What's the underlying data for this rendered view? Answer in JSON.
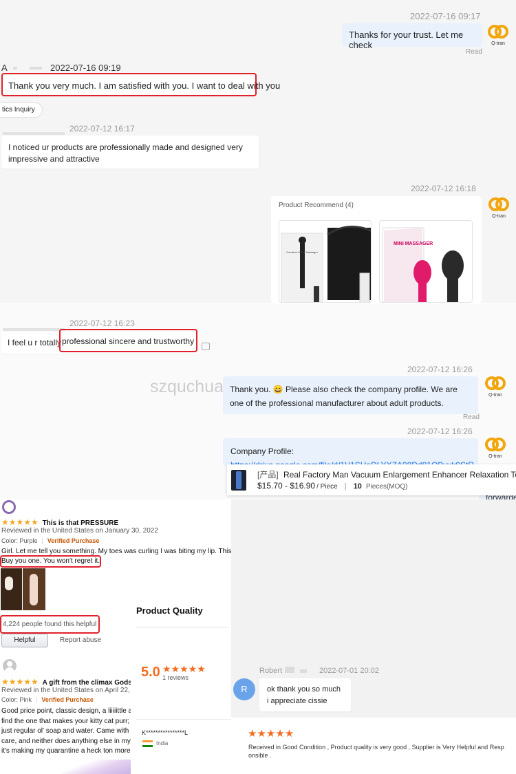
{
  "chat1": {
    "time1": "2022-07-16 09:17",
    "msg1": "Thanks for your trust. Let me check",
    "read1": "Read",
    "sender1": "A",
    "time2": "2022-07-16 09:19",
    "msg2": "Thank you very much. I am satisfied with you. I want to deal with you",
    "inquiry_tag": "tics Inquiry",
    "time3": "2022-07-12 16:17",
    "msg3": "I noticed ur products are professionally made and designed very impressive and attractive",
    "time4": "2022-07-12 16:18",
    "product_recommend": "Product Recommend (4)",
    "product1_text": "Cordless Wand Massager",
    "product2_text": "MINI MASSAGER"
  },
  "chat2": {
    "time1": "2022-07-12 16:23",
    "msg1_pre": "I feel u r totally ",
    "msg1_boxed": "professional sincere and trustworthy",
    "watermark": "szquchuang.en.alibaba.com",
    "time2": "2022-07-12 16:26",
    "msg2": "Thank you. 😄 Please also check the company profile. We are one of the professional manufacturer about adult products.",
    "read2": "Read",
    "time3": "2022-07-12 16:26",
    "profile_label": "Company Profile:",
    "profile_link": "https://drive.google.com/file/d/1V1SUnDLYXZA08Dd81OByvk0StR",
    "product_tag": "[产品]",
    "product_name": "Real Factory Man Vacuum Enlargement Enhancer Relaxation Tools",
    "product_price": "$15.70 - $16.90",
    "product_unit": "/ Piece",
    "product_moq_num": "10",
    "product_moq_label": "Pieces(MOQ)",
    "forwarded": "forwarde"
  },
  "review1": {
    "stars": "★★★★★",
    "title": "This is that PRESSURE",
    "meta": "Reviewed in the United States on January 30, 2022",
    "color_label": "Color: Purple",
    "verified": "Verified Purchase",
    "body1": "Girl. Let me tell you something. My toes was curling I was biting my lip. This",
    "body2": "Buy you one. You won't regret it.",
    "helpful_count": "4,224 people found this helpful",
    "helpful_btn": "Helpful",
    "report": "Report abuse"
  },
  "review2": {
    "stars": "★★★★★",
    "title": "A gift from the climax Gods.",
    "meta": "Reviewed in the United States on April 22,",
    "color_label": "Color: Pink",
    "verified": "Verified Purchase",
    "body": [
      "Good price point, classic design, a liiiiittle a",
      "find the one that makes your kitty cat purr;",
      "just regular ol' soap and water. Came with a",
      "care, and neither does anything else in my l",
      "it's making my quarantine a heck ton more"
    ]
  },
  "quality": {
    "title": "Product Quality",
    "score": "5.0",
    "stars": "★★★★★",
    "reviews": "1 reviews",
    "reviewer": "K****************L",
    "country": "India"
  },
  "chat3": {
    "sender": "Robert",
    "time": "2022-07-01 20:02",
    "avatar_letter": "R",
    "msg_line1": "ok thank you so much",
    "msg_line2": "i appreciate cissie",
    "stars": "★★★★★",
    "review_line1": "Received in Good Condition , Product quality is very good , Supplier is Very Helpful and Resp",
    "review_line2": "onsible ."
  },
  "colors": {
    "accent_red": "#e0202a",
    "bubble_blue": "#e8f1fc",
    "logo_orange": "#f2a60c",
    "star_orange": "#f26d21",
    "amazon_star": "#f6a51c",
    "link_blue": "#1a73e8",
    "avatar_blue": "#6aa3ea"
  }
}
